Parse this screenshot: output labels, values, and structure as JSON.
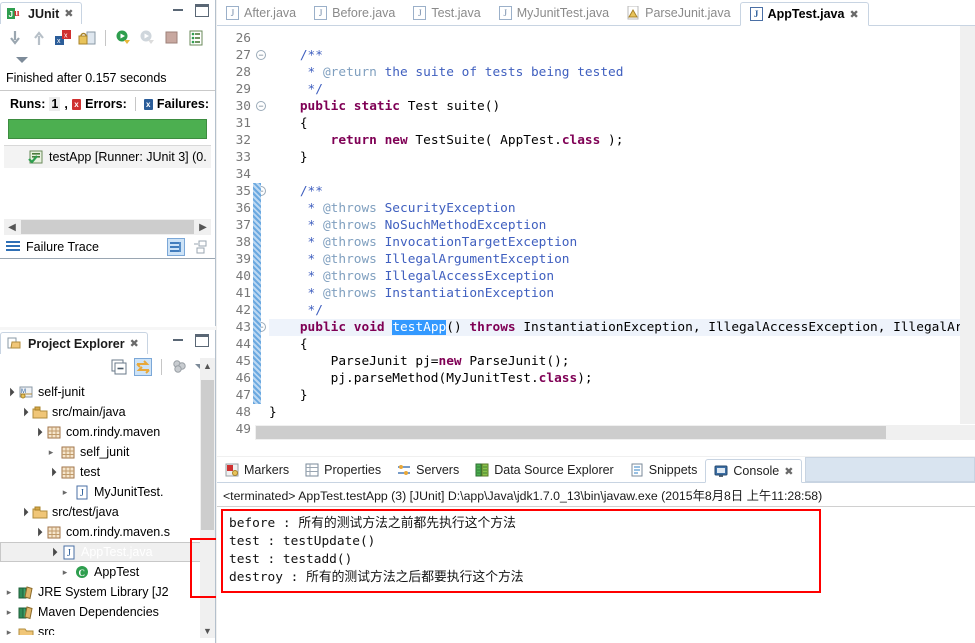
{
  "junit": {
    "tab_label": "JUnit",
    "tab_close": "✖",
    "toolbar_icons": [
      "next-failure-icon",
      "previous-failure-icon",
      "show-failures-only-icon",
      "lock-scroll-icon",
      "rerun-test-icon",
      "rerun-failed-tests-icon",
      "stop-icon",
      "test-run-history-icon"
    ],
    "status": "Finished after 0.157 seconds",
    "runs_label": "Runs:",
    "runs_value": "1",
    "runs_suffix": ",",
    "errors_label": "Errors:",
    "errors_value": "",
    "failures_label": "Failures:",
    "failures_value": "",
    "progress_color": "#4caf50",
    "tree_row": "testApp [Runner: JUnit 3] (0.",
    "failure_trace_label": "Failure Trace"
  },
  "project_explorer": {
    "tab_label": "Project Explorer",
    "tab_close": "✖",
    "tree": [
      {
        "indent": 0,
        "arrow": "open",
        "icon": "project-icon",
        "label": "self-junit"
      },
      {
        "indent": 1,
        "arrow": "open",
        "icon": "source-folder-icon",
        "label": "src/main/java"
      },
      {
        "indent": 2,
        "arrow": "open",
        "icon": "package-icon",
        "label": "com.rindy.maven"
      },
      {
        "indent": 3,
        "arrow": "closed",
        "icon": "package-icon",
        "label": "self_junit"
      },
      {
        "indent": 3,
        "arrow": "open",
        "icon": "package-icon",
        "label": "test"
      },
      {
        "indent": 4,
        "arrow": "closed",
        "icon": "java-file-icon",
        "label": "MyJunitTest."
      },
      {
        "indent": 1,
        "arrow": "open",
        "icon": "source-folder-icon",
        "label": "src/test/java"
      },
      {
        "indent": 2,
        "arrow": "open",
        "icon": "package-icon",
        "label": "com.rindy.maven.s"
      },
      {
        "indent": 3,
        "arrow": "open",
        "icon": "java-file-icon",
        "label": "AppTest.java",
        "selected": true
      },
      {
        "indent": 4,
        "arrow": "closed",
        "icon": "class-icon",
        "label": "AppTest"
      },
      {
        "indent": 0,
        "arrow": "closed",
        "icon": "library-icon",
        "label": "JRE System Library [J2"
      },
      {
        "indent": 0,
        "arrow": "closed",
        "icon": "library-icon",
        "label": "Maven Dependencies"
      },
      {
        "indent": 0,
        "arrow": "closed",
        "icon": "folder-icon",
        "label": "src"
      }
    ]
  },
  "editor": {
    "tabs": [
      {
        "label": "After.java",
        "icon": "java-file-icon",
        "active": false
      },
      {
        "label": "Before.java",
        "icon": "java-file-icon",
        "active": false
      },
      {
        "label": "Test.java",
        "icon": "java-file-icon",
        "active": false
      },
      {
        "label": "MyJunitTest.java",
        "icon": "java-file-icon",
        "active": false
      },
      {
        "label": "ParseJunit.java",
        "icon": "java-warning-file-icon",
        "active": false
      },
      {
        "label": "AppTest.java",
        "icon": "java-file-icon",
        "active": true,
        "close": "✖"
      }
    ],
    "first_line": 26,
    "lines": [
      {
        "n": 26,
        "fold": false,
        "changed": false,
        "html": ""
      },
      {
        "n": 27,
        "fold": true,
        "changed": false,
        "html": "    <span class='cmt'>/**</span>"
      },
      {
        "n": 28,
        "fold": false,
        "changed": false,
        "html": "     <span class='cmt'>* </span><span class='tag'>@return</span><span class='cmt'> the suite of tests being tested</span>"
      },
      {
        "n": 29,
        "fold": false,
        "changed": false,
        "html": "     <span class='cmt'>*/</span>"
      },
      {
        "n": 30,
        "fold": true,
        "changed": false,
        "html": "    <span class='kw'>public</span> <span class='kw'>static</span> Test suite()"
      },
      {
        "n": 31,
        "fold": false,
        "changed": false,
        "html": "    {"
      },
      {
        "n": 32,
        "fold": false,
        "changed": false,
        "html": "        <span class='kw'>return</span> <span class='kw'>new</span> TestSuite( AppTest.<span class='kw'>class</span> );"
      },
      {
        "n": 33,
        "fold": false,
        "changed": false,
        "html": "    }"
      },
      {
        "n": 34,
        "fold": false,
        "changed": false,
        "html": ""
      },
      {
        "n": 35,
        "fold": true,
        "changed": true,
        "html": "    <span class='cmt'>/**</span>"
      },
      {
        "n": 36,
        "fold": false,
        "changed": true,
        "html": "     <span class='cmt'>* </span><span class='tag'>@throws</span><span class='cmt'> SecurityException</span>"
      },
      {
        "n": 37,
        "fold": false,
        "changed": true,
        "html": "     <span class='cmt'>* </span><span class='tag'>@throws</span><span class='cmt'> NoSuchMethodException</span>"
      },
      {
        "n": 38,
        "fold": false,
        "changed": true,
        "html": "     <span class='cmt'>* </span><span class='tag'>@throws</span><span class='cmt'> InvocationTargetException</span>"
      },
      {
        "n": 39,
        "fold": false,
        "changed": true,
        "html": "     <span class='cmt'>* </span><span class='tag'>@throws</span><span class='cmt'> IllegalArgumentException</span>"
      },
      {
        "n": 40,
        "fold": false,
        "changed": true,
        "html": "     <span class='cmt'>* </span><span class='tag'>@throws</span><span class='cmt'> IllegalAccessException</span>"
      },
      {
        "n": 41,
        "fold": false,
        "changed": true,
        "html": "     <span class='cmt'>* </span><span class='tag'>@throws</span><span class='cmt'> InstantiationException</span>"
      },
      {
        "n": 42,
        "fold": false,
        "changed": true,
        "html": "     <span class='cmt'>*/</span>"
      },
      {
        "n": 43,
        "fold": true,
        "changed": true,
        "highlight": true,
        "html": "    <span class='kw'>public</span> <span class='kw'>void</span> <span class='sel'>testApp</span>() <span class='kw'>throws</span> InstantiationException, IllegalAccessException, IllegalAr"
      },
      {
        "n": 44,
        "fold": false,
        "changed": true,
        "html": "    {"
      },
      {
        "n": 45,
        "fold": false,
        "changed": true,
        "html": "        ParseJunit pj=<span class='kw'>new</span> ParseJunit();"
      },
      {
        "n": 46,
        "fold": false,
        "changed": true,
        "html": "        pj.parseMethod(MyJunitTest.<span class='kw'>class</span>);"
      },
      {
        "n": 47,
        "fold": false,
        "changed": true,
        "html": "    }"
      },
      {
        "n": 48,
        "fold": false,
        "changed": false,
        "html": "}"
      },
      {
        "n": 49,
        "fold": false,
        "changed": false,
        "html": ""
      }
    ]
  },
  "console": {
    "tabs": [
      {
        "label": "Markers",
        "icon": "markers-icon",
        "active": false
      },
      {
        "label": "Properties",
        "icon": "properties-icon",
        "active": false
      },
      {
        "label": "Servers",
        "icon": "servers-icon",
        "active": false
      },
      {
        "label": "Data Source Explorer",
        "icon": "datasource-icon",
        "active": false
      },
      {
        "label": "Snippets",
        "icon": "snippets-icon",
        "active": false
      },
      {
        "label": "Console",
        "icon": "console-icon",
        "active": true,
        "close": "✖"
      }
    ],
    "terminated_line": "<terminated> AppTest.testApp (3) [JUnit] D:\\app\\Java\\jdk1.7.0_13\\bin\\javaw.exe (2015年8月8日 上午11:28:58)",
    "output": [
      "before : 所有的测试方法之前都先执行这个方法",
      "test : testUpdate()",
      "test : testadd()",
      "destroy : 所有的测试方法之后都要执行这个方法"
    ],
    "highlight_color": "#ff0000"
  }
}
